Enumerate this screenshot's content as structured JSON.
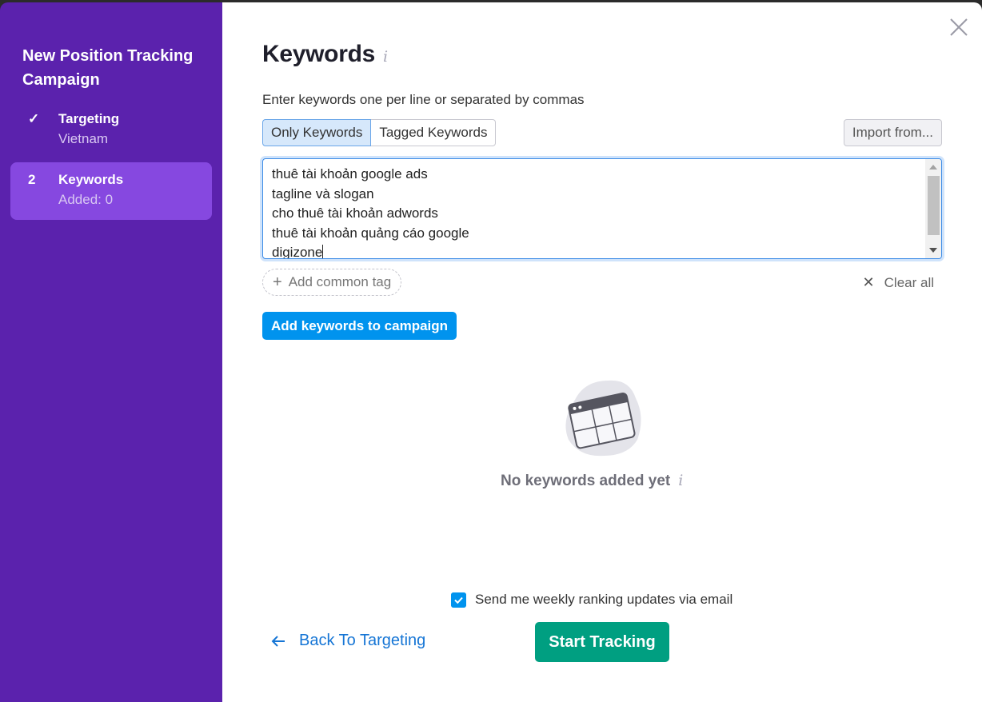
{
  "sidebar": {
    "title_line1": "New Position Tracking",
    "title_line2": "Campaign",
    "steps": [
      {
        "marker": "✓",
        "name": "Targeting",
        "sub": "Vietnam",
        "state": "done"
      },
      {
        "marker": "2",
        "name": "Keywords",
        "sub": "Added: 0",
        "state": "active"
      }
    ]
  },
  "main": {
    "title": "Keywords",
    "info_glyph": "i",
    "hint": "Enter keywords one per line or separated by commas",
    "modes": [
      "Only Keywords",
      "Tagged Keywords"
    ],
    "selected_mode": "Only Keywords",
    "import_label": "Import from...",
    "keywords": [
      "thuê tài khoản google ads",
      "tagline và slogan",
      "cho thuê tài khoản adwords",
      "thuê tài khoản quảng cáo google",
      "digizone"
    ],
    "add_tag_label": "Add common tag",
    "clear_all_label": "Clear all",
    "add_button_label": "Add keywords to campaign",
    "empty_text": "No keywords added yet",
    "email_updates_label": "Send me weekly ranking updates via email",
    "email_updates_checked": true,
    "back_label": "Back To Targeting",
    "start_label": "Start Tracking"
  },
  "colors": {
    "sidebar_bg": "#5b22ad",
    "active_step_bg": "#8648e0",
    "primary_blue": "#0093ee",
    "start_green": "#009f81",
    "link_blue": "#1575d5"
  },
  "icons": {
    "close": "close-icon",
    "check": "check-icon",
    "plus": "plus-icon",
    "clear": "x-icon",
    "empty": "empty-table-illustration",
    "back": "arrow-left-icon",
    "checkbox": "checkbox-checked-icon"
  }
}
